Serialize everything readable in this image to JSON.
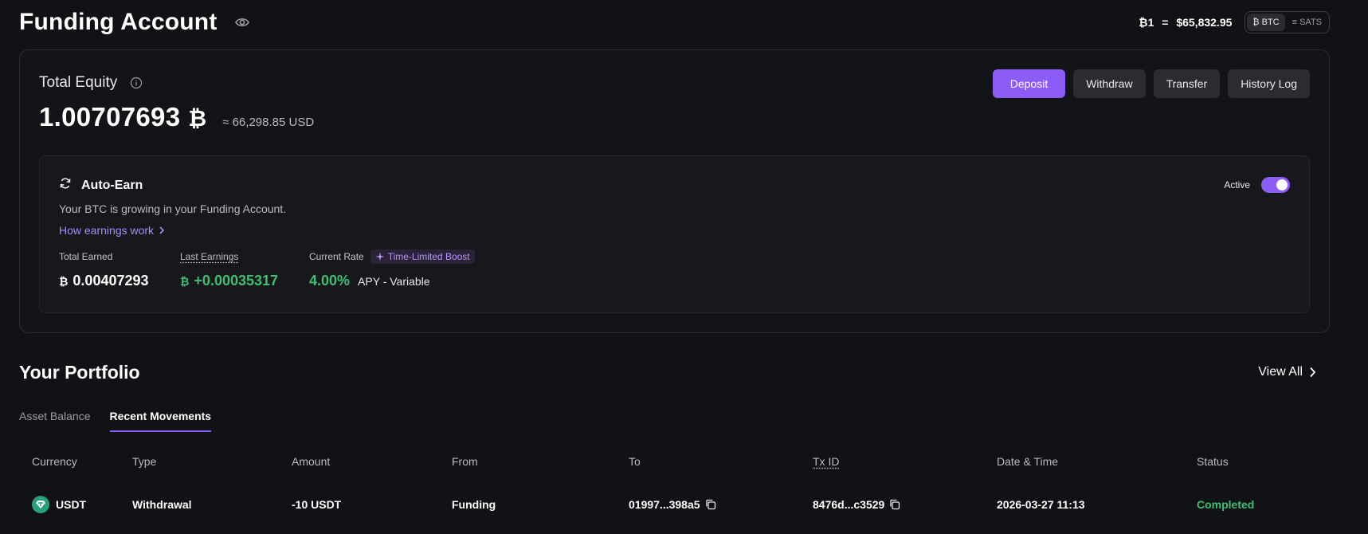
{
  "header": {
    "title": "Funding Account",
    "price_left": "₿1",
    "price_eq": "=",
    "price_value": "$65,832.95",
    "units": [
      {
        "label": "₿ BTC",
        "active": true
      },
      {
        "label": "≡ SATS",
        "active": false
      }
    ]
  },
  "equity": {
    "label": "Total Equity",
    "value": "1.00707693",
    "symbol": "₿",
    "usd": "≈ 66,298.85 USD",
    "actions": {
      "deposit": "Deposit",
      "withdraw": "Withdraw",
      "transfer": "Transfer",
      "history": "History Log"
    }
  },
  "autoearn": {
    "title": "Auto-Earn",
    "status_label": "Active",
    "enabled": true,
    "description": "Your BTC is growing in your Funding Account.",
    "link": "How earnings work",
    "total_earned_label": "Total Earned",
    "total_earned_symbol": "₿",
    "total_earned_value": "0.00407293",
    "last_earnings_label": "Last Earnings",
    "last_earnings_symbol": "₿",
    "last_earnings_value": "+0.00035317",
    "current_rate_label": "Current Rate",
    "boost_label": "Time-Limited Boost",
    "rate_value": "4.00%",
    "rate_suffix": "APY - Variable"
  },
  "portfolio": {
    "title": "Your Portfolio",
    "view_all": "View All",
    "tabs": [
      {
        "label": "Asset Balance",
        "active": false
      },
      {
        "label": "Recent Movements",
        "active": true
      }
    ],
    "columns": [
      "Currency",
      "Type",
      "Amount",
      "From",
      "To",
      "Tx ID",
      "Date & Time",
      "Status"
    ],
    "rows": [
      {
        "currency": "USDT",
        "type": "Withdrawal",
        "amount": "-10 USDT",
        "from": "Funding",
        "to": "01997...398a5",
        "tx_id": "8476d...c3529",
        "datetime": "2026-03-27 11:13",
        "status": "Completed"
      }
    ]
  },
  "colors": {
    "accent": "#8b5cf6",
    "positive": "#3fbf72",
    "usdt": "#26a17b",
    "background": "#111215"
  }
}
